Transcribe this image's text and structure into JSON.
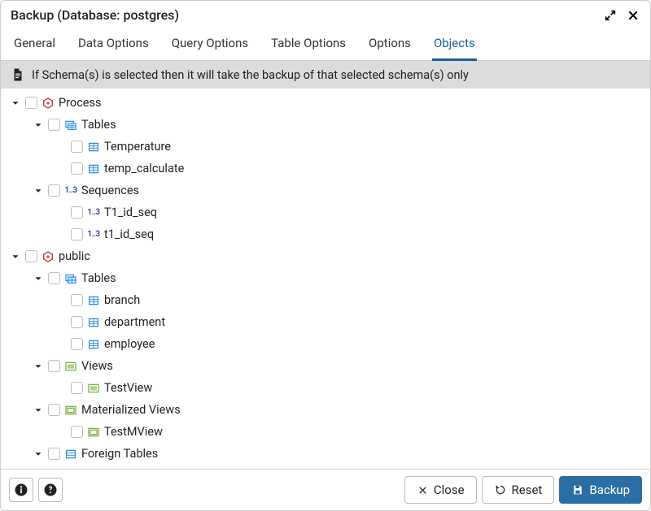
{
  "header": {
    "title": "Backup (Database: postgres)"
  },
  "tabs": {
    "general": "General",
    "data_options": "Data Options",
    "query_options": "Query Options",
    "table_options": "Table Options",
    "options": "Options",
    "objects": "Objects",
    "active": "objects"
  },
  "info": {
    "text": "If Schema(s) is selected then it will take the backup of that selected schema(s) only"
  },
  "tree": [
    {
      "label": "Process",
      "icon": "schema",
      "expanded": true,
      "children": [
        {
          "label": "Tables",
          "icon": "tables",
          "expanded": true,
          "children": [
            {
              "label": "Temperature",
              "icon": "table"
            },
            {
              "label": "temp_calculate",
              "icon": "table"
            }
          ]
        },
        {
          "label": "Sequences",
          "icon": "sequence",
          "expanded": true,
          "children": [
            {
              "label": "T1_id_seq",
              "icon": "sequence"
            },
            {
              "label": "t1_id_seq",
              "icon": "sequence"
            }
          ]
        }
      ]
    },
    {
      "label": "public",
      "icon": "schema",
      "expanded": true,
      "children": [
        {
          "label": "Tables",
          "icon": "tables",
          "expanded": true,
          "children": [
            {
              "label": "branch",
              "icon": "table"
            },
            {
              "label": "department",
              "icon": "table"
            },
            {
              "label": "employee",
              "icon": "table"
            }
          ]
        },
        {
          "label": "Views",
          "icon": "view",
          "expanded": true,
          "children": [
            {
              "label": "TestView",
              "icon": "view"
            }
          ]
        },
        {
          "label": "Materialized Views",
          "icon": "mview",
          "expanded": true,
          "children": [
            {
              "label": "TestMView",
              "icon": "mview"
            }
          ]
        },
        {
          "label": "Foreign Tables",
          "icon": "ftable",
          "expanded": true,
          "children": []
        }
      ]
    }
  ],
  "footer": {
    "close": "Close",
    "reset": "Reset",
    "backup": "Backup"
  },
  "colors": {
    "accent": "#2b6ea4"
  }
}
